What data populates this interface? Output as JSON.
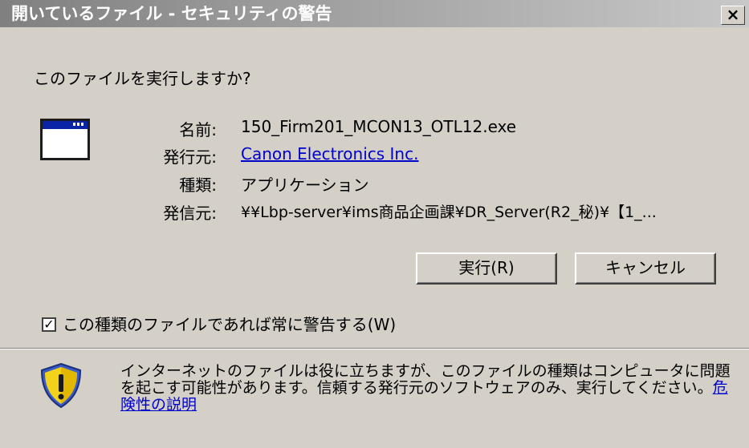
{
  "window": {
    "title": "開いているファイル - セキュリティの警告",
    "close_glyph": "×"
  },
  "question": "このファイルを実行しますか?",
  "file_info": {
    "name_label": "名前:",
    "name_value": "150_Firm201_MCON13_OTL12.exe",
    "publisher_label": "発行元:",
    "publisher_value": "Canon Electronics Inc.",
    "type_label": "種類:",
    "type_value": "アプリケーション",
    "from_label": "発信元:",
    "from_value": "¥¥Lbp-server¥ims商品企画課¥DR_Server(R2_秘)¥【1_..."
  },
  "buttons": {
    "run": "実行(R)",
    "cancel": "キャンセル"
  },
  "checkbox": {
    "checked": true,
    "mark": "✓",
    "label": "この種類のファイルであれば常に警告する(W)"
  },
  "warning": {
    "text": "インターネットのファイルは役に立ちますが、このファイルの種類はコンピュータに問題を起こす可能性があります。信頼する発行元のソフトウェアのみ、実行してください",
    "link_prefix": "。",
    "link": "危険性の説明"
  },
  "icons": {
    "file": "application-window-icon",
    "warning": "security-shield-warning-icon"
  },
  "colors": {
    "dialog_bg": "#d4d0c8",
    "link": "#0000cc",
    "shield_yellow": "#f2d21a",
    "shield_blue": "#3a5cc8"
  }
}
